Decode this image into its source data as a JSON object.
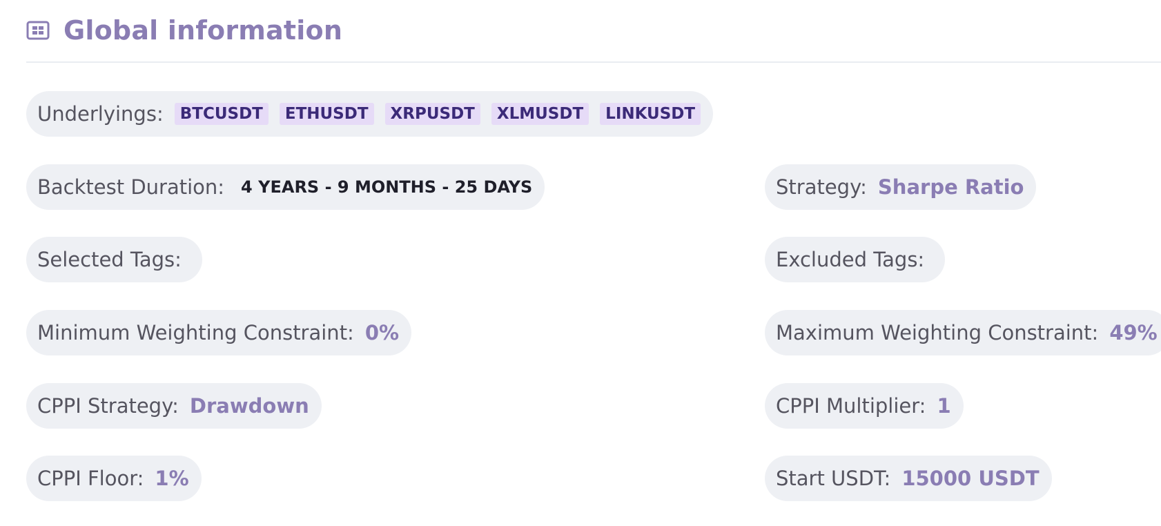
{
  "header": {
    "title": "Global information",
    "icon": "dashboard-grid-icon",
    "accent_color": "#8a7db3"
  },
  "underlyings": {
    "label": "Underlyings:",
    "tags": [
      "BTCUSDT",
      "ETHUSDT",
      "XRPUSDT",
      "XLMUSDT",
      "LINKUSDT"
    ]
  },
  "backtest_duration": {
    "label": "Backtest Duration:",
    "value": "4 YEARS - 9 MONTHS - 25 DAYS"
  },
  "strategy": {
    "label": "Strategy:",
    "value": "Sharpe Ratio"
  },
  "selected_tags": {
    "label": "Selected Tags:"
  },
  "excluded_tags": {
    "label": "Excluded Tags:"
  },
  "min_weight": {
    "label": "Minimum Weighting Constraint:",
    "value": "0%"
  },
  "max_weight": {
    "label": "Maximum Weighting Constraint:",
    "value": "49%"
  },
  "cppi_strategy": {
    "label": "CPPI Strategy:",
    "value": "Drawdown"
  },
  "cppi_multiplier": {
    "label": "CPPI Multiplier:",
    "value": "1"
  },
  "cppi_floor": {
    "label": "CPPI Floor:",
    "value": "1%"
  },
  "start_usdt": {
    "label": "Start USDT:",
    "value": "15000 USDT"
  }
}
